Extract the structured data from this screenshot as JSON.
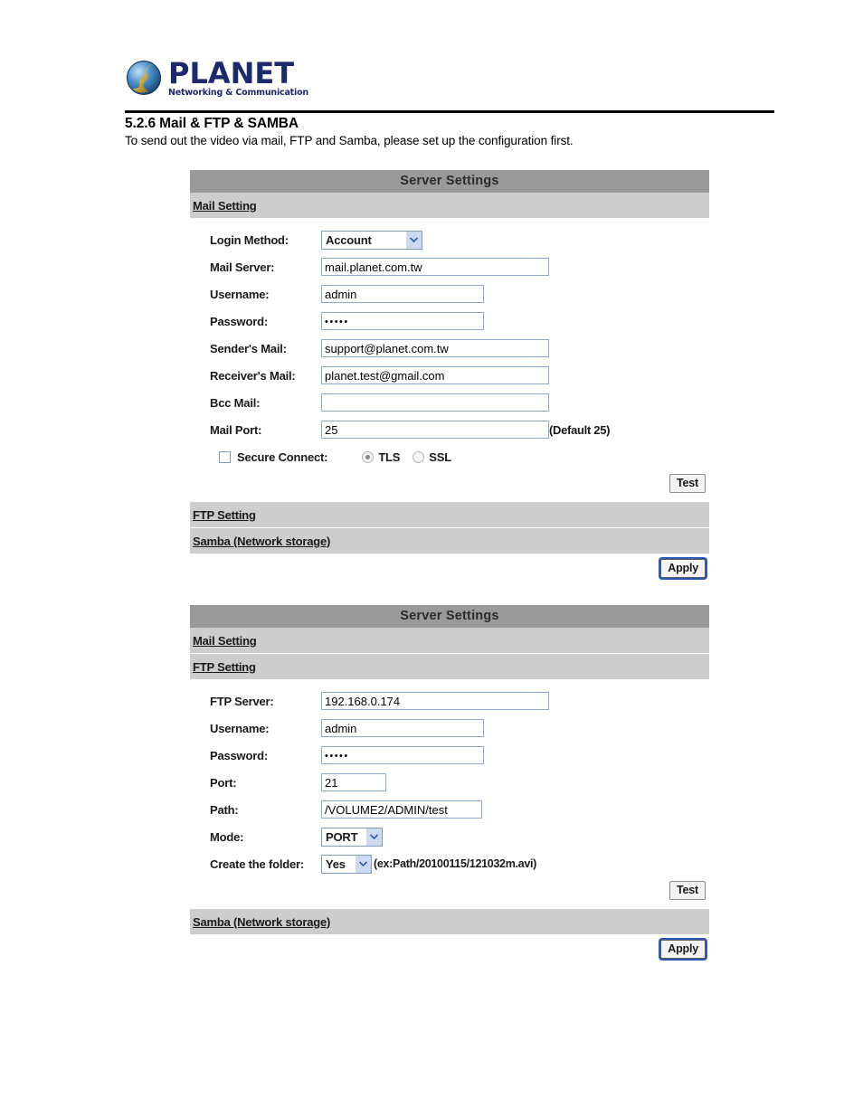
{
  "document": {
    "logo": {
      "wordmark": "PLANET",
      "tagline": "Networking & Communication"
    },
    "heading": "5.2.6 Mail & FTP & SAMBA",
    "description": "To send out the video via mail, FTP and Samba, please set up the configuration first."
  },
  "panel_mail": {
    "title": "Server Settings",
    "sections": {
      "mail": "Mail Setting",
      "ftp": "FTP Setting",
      "samba": "Samba (Network storage)"
    },
    "fields": {
      "login_method": {
        "label": "Login Method:",
        "value": "Account"
      },
      "mail_server": {
        "label": "Mail Server:",
        "value": "mail.planet.com.tw",
        "placeholder": ""
      },
      "username": {
        "label": "Username:",
        "value": "admin",
        "placeholder": ""
      },
      "password": {
        "label": "Password:",
        "value": "•••••",
        "placeholder": ""
      },
      "sender_mail": {
        "label": "Sender's Mail:",
        "value": "support@planet.com.tw",
        "placeholder": ""
      },
      "receiver_mail": {
        "label": "Receiver's Mail:",
        "value": "planet.test@gmail.com",
        "placeholder": ""
      },
      "bcc_mail": {
        "label": "Bcc Mail:",
        "value": "",
        "placeholder": ""
      },
      "mail_port": {
        "label": "Mail Port:",
        "value": "25",
        "hint": "(Default 25)",
        "placeholder": ""
      },
      "secure_connect": {
        "label": "Secure Connect:",
        "checked": false
      },
      "tls": {
        "label": "TLS",
        "selected": true
      },
      "ssl": {
        "label": "SSL",
        "selected": false
      }
    },
    "buttons": {
      "test": "Test",
      "apply": "Apply"
    }
  },
  "panel_ftp": {
    "title": "Server Settings",
    "sections": {
      "mail": "Mail Setting",
      "ftp": "FTP Setting",
      "samba": "Samba (Network storage)"
    },
    "fields": {
      "ftp_server": {
        "label": "FTP Server:",
        "value": "192.168.0.174",
        "placeholder": ""
      },
      "username": {
        "label": "Username:",
        "value": "admin",
        "placeholder": ""
      },
      "password": {
        "label": "Password:",
        "value": "•••••",
        "placeholder": ""
      },
      "port": {
        "label": "Port:",
        "value": "21",
        "placeholder": ""
      },
      "path": {
        "label": "Path:",
        "value": "/VOLUME2/ADMIN/test",
        "placeholder": ""
      },
      "mode": {
        "label": "Mode:",
        "value": "PORT"
      },
      "create_folder": {
        "label": "Create the folder:",
        "value": "Yes",
        "hint": "(ex:Path/20100115/121032m.avi)"
      }
    },
    "buttons": {
      "test": "Test",
      "apply": "Apply"
    }
  },
  "colors": {
    "panel_header": "#9a9a9a",
    "section_bar": "#cdcdcd",
    "input_border": "#8faac9",
    "logo_blue": "#1b2a6b",
    "focus_ring": "#2b57b8"
  }
}
